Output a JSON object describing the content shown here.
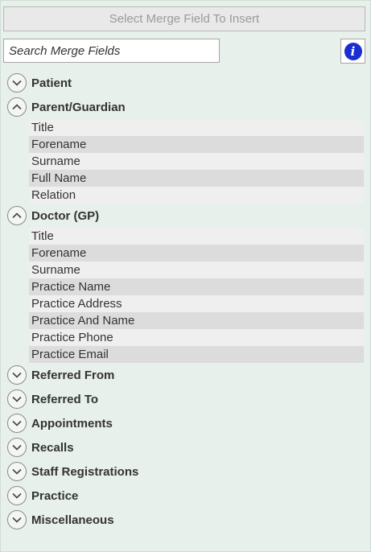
{
  "toolbar": {
    "insert_label": "Select Merge Field To Insert"
  },
  "search": {
    "placeholder": "Search Merge Fields",
    "value": ""
  },
  "info": {
    "glyph": "i"
  },
  "groups": [
    {
      "label": "Patient",
      "expanded": false,
      "items": []
    },
    {
      "label": "Parent/Guardian",
      "expanded": true,
      "items": [
        "Title",
        "Forename",
        "Surname",
        "Full Name",
        "Relation"
      ]
    },
    {
      "label": "Doctor (GP)",
      "expanded": true,
      "items": [
        "Title",
        "Forename",
        "Surname",
        "Practice Name",
        "Practice Address",
        "Practice And Name",
        "Practice Phone",
        "Practice Email"
      ]
    },
    {
      "label": "Referred From",
      "expanded": false,
      "items": []
    },
    {
      "label": "Referred To",
      "expanded": false,
      "items": []
    },
    {
      "label": "Appointments",
      "expanded": false,
      "items": []
    },
    {
      "label": "Recalls",
      "expanded": false,
      "items": []
    },
    {
      "label": "Staff Registrations",
      "expanded": false,
      "items": []
    },
    {
      "label": "Practice",
      "expanded": false,
      "items": []
    },
    {
      "label": "Miscellaneous",
      "expanded": false,
      "items": []
    }
  ]
}
